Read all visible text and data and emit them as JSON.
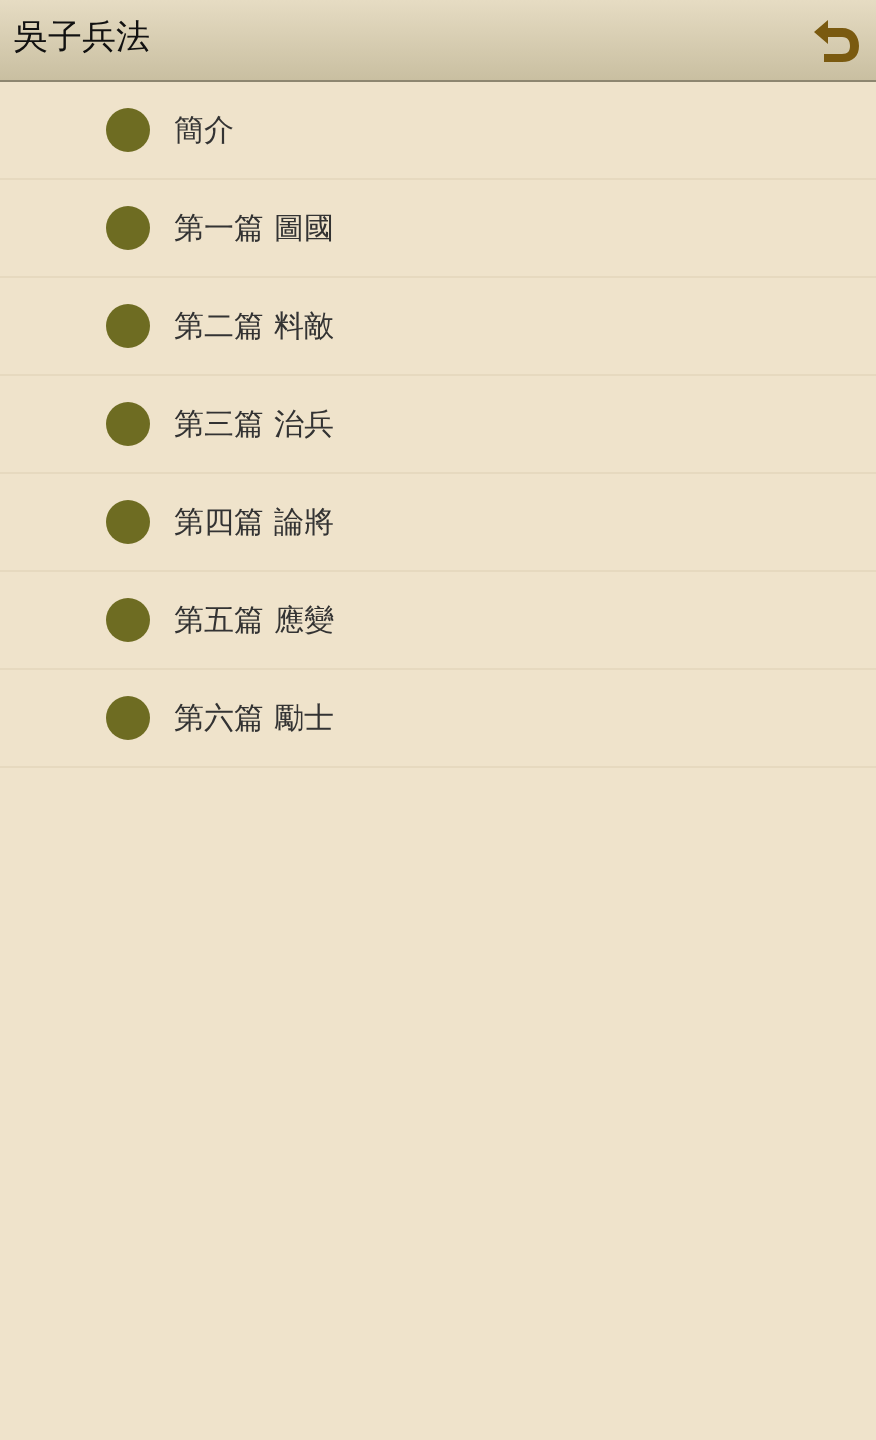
{
  "header": {
    "title": "吳子兵法"
  },
  "items": [
    {
      "label": "簡介"
    },
    {
      "label": "第一篇 圖國"
    },
    {
      "label": "第二篇 料敵"
    },
    {
      "label": "第三篇 治兵"
    },
    {
      "label": "第四篇 論將"
    },
    {
      "label": "第五篇 應變"
    },
    {
      "label": "第六篇 勵士"
    }
  ]
}
